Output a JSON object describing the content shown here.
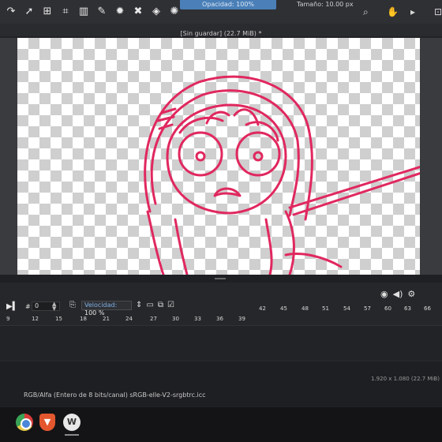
{
  "toolbar": {
    "opacity_label": "Opacidad: 100%",
    "size_label": "Tamaño: 10.00 px",
    "tools": [
      "redo-icon",
      "transform-icon",
      "crop-icon",
      "gradient-icon",
      "eyedropper-icon",
      "sparkle-icon",
      "brush-icon",
      "fill-icon",
      "contiguous-select-icon",
      "rect-select-icon",
      "ellipse-select-icon",
      "polygon-select-icon",
      "freehand-select-icon",
      "magic-wand-icon",
      "similar-select-icon",
      "bezier-select-icon",
      "zoom-icon",
      "pan-icon"
    ]
  },
  "document": {
    "title": "[Sin guardar]  (22.7 MiB) *"
  },
  "timeline": {
    "frame_hash": "#",
    "frame_value": "0",
    "speed_label": "Velocidad:",
    "speed_value": "100 %",
    "top_frames": [
      "42",
      "45",
      "48",
      "51",
      "54",
      "57",
      "60",
      "63",
      "66"
    ],
    "bottom_frames": [
      "9",
      "12",
      "15",
      "18",
      "21",
      "24",
      "27",
      "30",
      "33",
      "36",
      "39"
    ]
  },
  "status": {
    "resolution": "1.920 x 1.080  (22.7 MiB)",
    "color_profile": "RGB/Alfa (Entero de 8 bits/canal)  sRGB-elle-V2-srgbtrc.icc"
  },
  "colors": {
    "stroke": "#e0285f",
    "accent": "#4a7fb8"
  }
}
